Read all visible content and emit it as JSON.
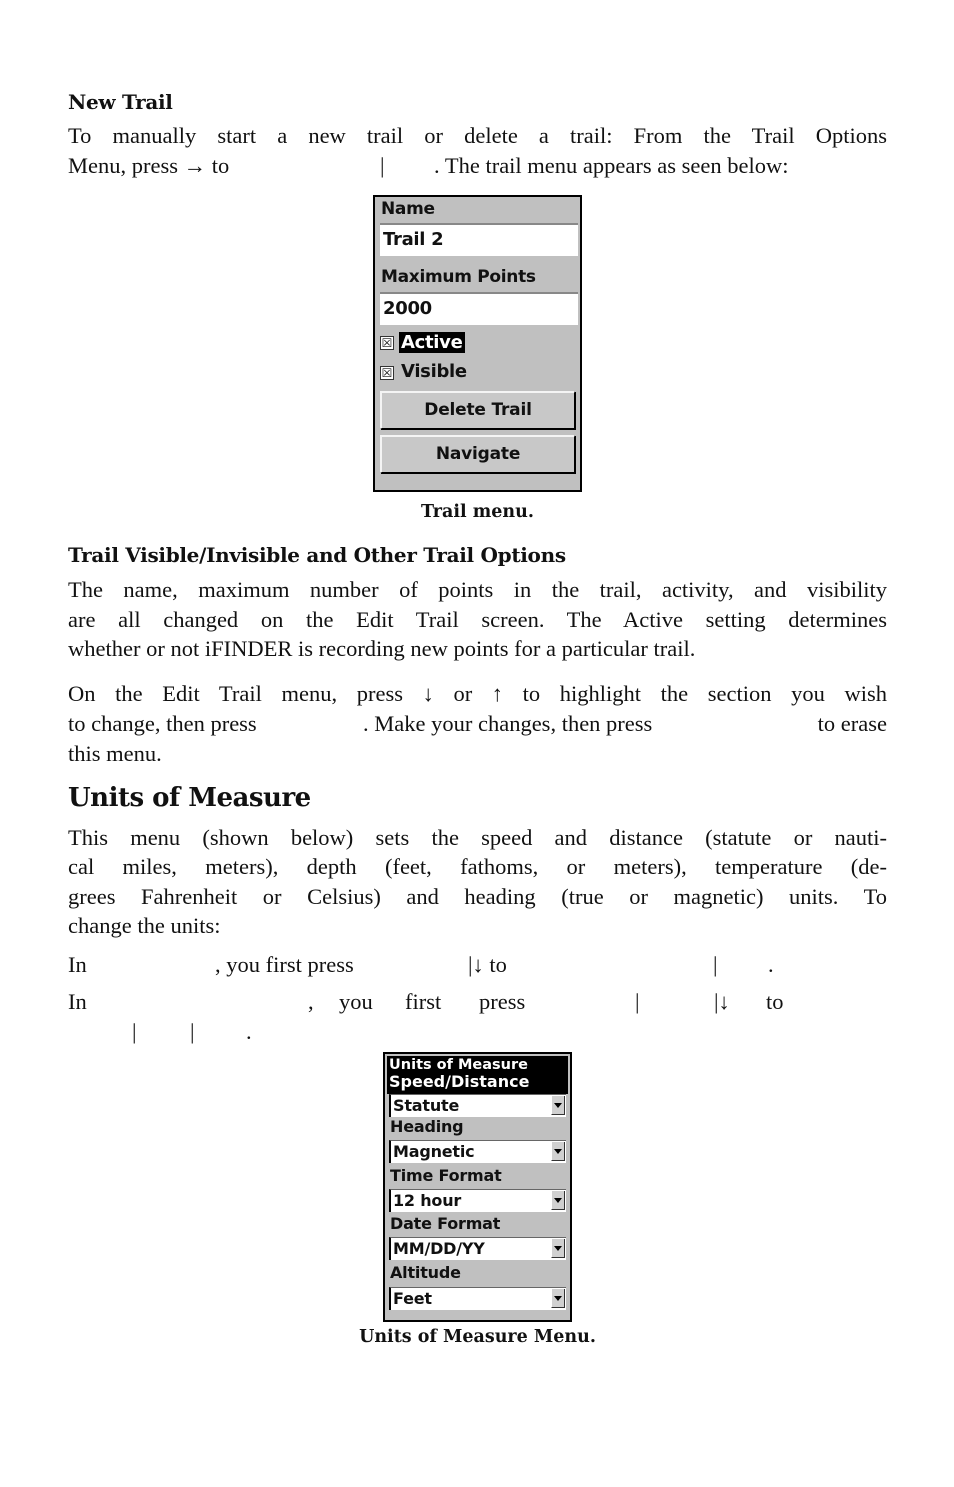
{
  "new_trail": {
    "heading": "New Trail",
    "line1": "To manually start a new trail or delete a trail: From the Trail Options",
    "line2_a": "Menu, press → to",
    "line2_sep": "|",
    "line2_b": ". The trail menu appears as seen below:"
  },
  "trail_menu": {
    "name_label": "Name",
    "name_value": "Trail 2",
    "max_points_label": "Maximum Points",
    "max_points_value": "2000",
    "checkbox_mark": "☒",
    "active_label": "Active",
    "active_checked": true,
    "visible_label": "Visible",
    "visible_checked": true,
    "delete_button": "Delete Trail",
    "navigate_button": "Navigate",
    "caption": "Trail menu."
  },
  "trail_options": {
    "heading": "Trail Visible/Invisible and Other Trail Options",
    "line1": "The name, maximum number of points in the trail, activity, and visibility",
    "line2": "are all changed on the Edit Trail screen. The Active setting determines",
    "line3": "whether or not iFINDER is recording new points for a particular trail.",
    "p2_line1": "On the Edit Trail menu, press ↓ or ↑ to highlight the section you wish",
    "p2_line2_a": "to change, then press",
    "p2_line2_b": ". Make your changes, then press",
    "p2_line2_c": "to erase",
    "p2_line3": "this menu."
  },
  "units": {
    "heading": "Units of Measure",
    "line1": "This menu (shown below) sets the speed and distance (statute or nauti-",
    "line2": "cal miles, meters), depth (feet, fathoms, or meters), temperature (de-",
    "line3": "grees Fahrenheit or Celsius) and heading (true or magnetic) units. To",
    "line4": "change the units:",
    "step1_a": "In",
    "step1_b": ", you first press",
    "step1_c": "|↓ to",
    "step1_d": "|",
    "step1_e": ".",
    "step2_a": "In",
    "step2_b": ",",
    "step2_c": "you",
    "step2_d": "first",
    "step2_e": "press",
    "step2_f": "|",
    "step2_g": "|↓",
    "step2_h": "to",
    "step3_a": "|",
    "step3_b": "|",
    "step3_c": "."
  },
  "units_menu": {
    "title": "Units of Measure",
    "fields": [
      {
        "label": "Speed/Distance",
        "value": "Statute"
      },
      {
        "label": "Heading",
        "value": "Magnetic"
      },
      {
        "label": "Time Format",
        "value": "12 hour"
      },
      {
        "label": "Date Format",
        "value": "MM/DD/YY"
      },
      {
        "label": "Altitude",
        "value": "Feet"
      }
    ],
    "caption": "Units of Measure Menu."
  }
}
